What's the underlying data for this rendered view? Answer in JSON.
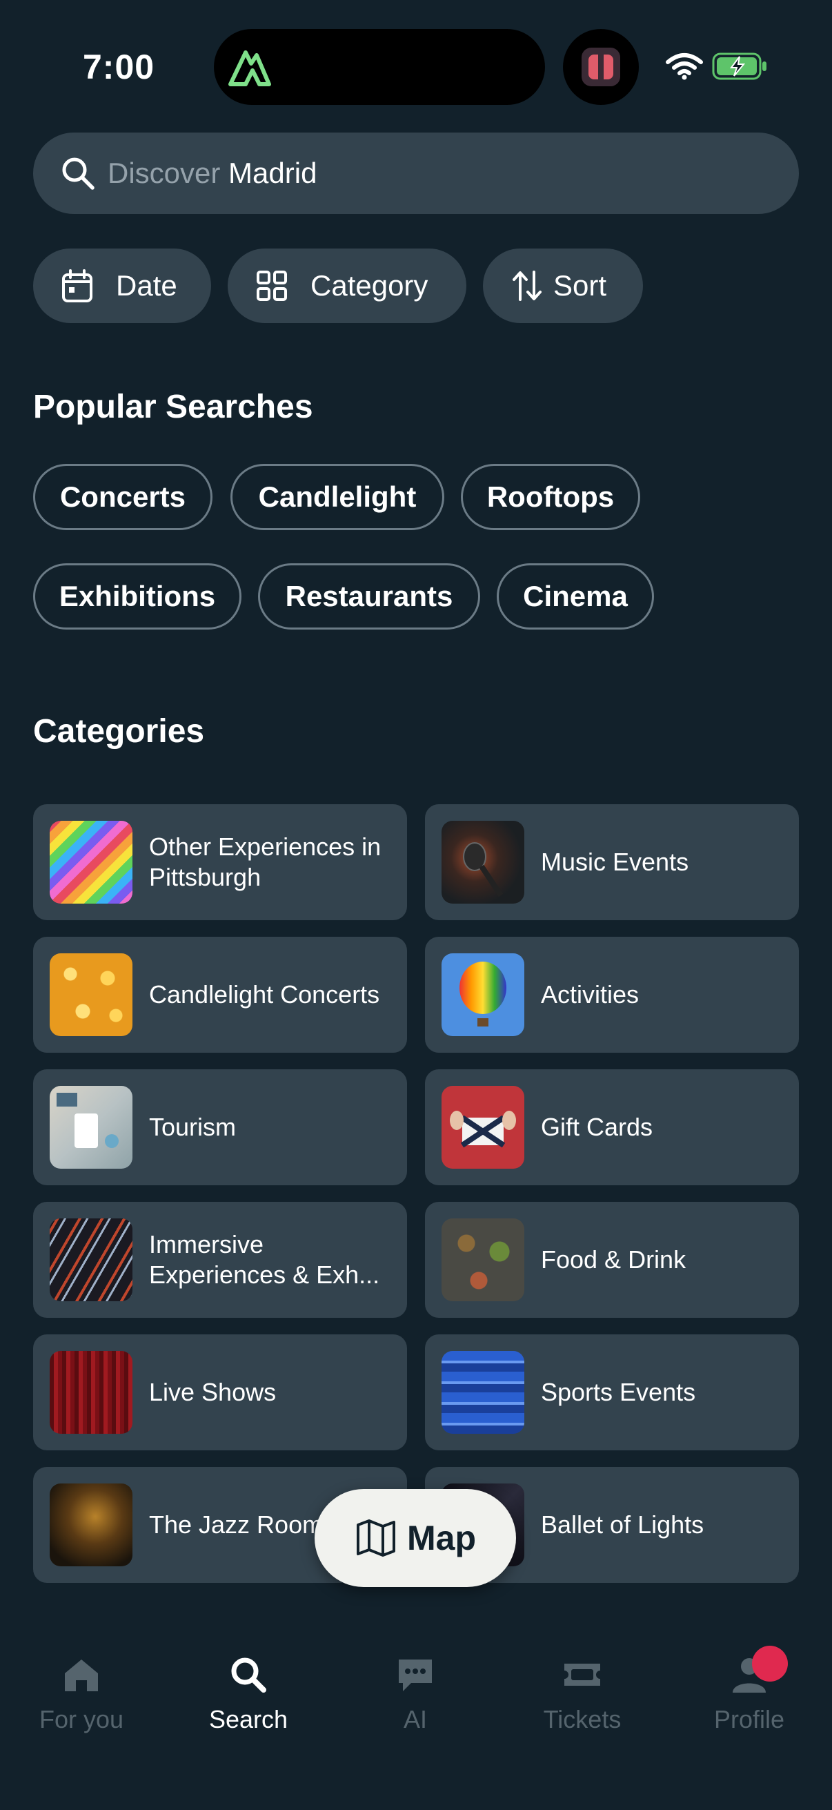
{
  "status_bar": {
    "time": "7:00"
  },
  "search": {
    "placeholder": "Discover",
    "value": "Madrid"
  },
  "filters": [
    {
      "label": "Date",
      "icon": "calendar-icon"
    },
    {
      "label": "Category",
      "icon": "grid-icon"
    },
    {
      "label": "Sort",
      "icon": "sort-arrows-icon"
    }
  ],
  "popular_searches": {
    "title": "Popular Searches",
    "items": [
      "Concerts",
      "Candlelight",
      "Rooftops",
      "Exhibitions",
      "Restaurants",
      "Cinema"
    ]
  },
  "categories": {
    "title": "Categories",
    "items": [
      {
        "label": "Other Experiences in Pittsburgh",
        "thumb": "rainbow-stripes"
      },
      {
        "label": "Music Events",
        "thumb": "microphone"
      },
      {
        "label": "Candlelight Concerts",
        "thumb": "candles"
      },
      {
        "label": "Activities",
        "thumb": "hot-air-balloon"
      },
      {
        "label": "Tourism",
        "thumb": "map-and-phone"
      },
      {
        "label": "Gift Cards",
        "thumb": "gift-box"
      },
      {
        "label": "Immersive Experiences & Exh...",
        "thumb": "light-streaks"
      },
      {
        "label": "Food & Drink",
        "thumb": "food-table"
      },
      {
        "label": "Live Shows",
        "thumb": "red-curtain"
      },
      {
        "label": "Sports Events",
        "thumb": "stadium-seats"
      },
      {
        "label": "The Jazz Room",
        "thumb": "saxophone-player"
      },
      {
        "label": "Ballet of Lights",
        "thumb": "ballet-lights"
      }
    ]
  },
  "map_button": {
    "label": "Map",
    "icon": "map-icon"
  },
  "bottom_nav": {
    "items": [
      {
        "label": "For you",
        "icon": "home-icon",
        "active": false
      },
      {
        "label": "Search",
        "icon": "search-icon",
        "active": true
      },
      {
        "label": "AI",
        "icon": "chat-bubble-icon",
        "active": false
      },
      {
        "label": "Tickets",
        "icon": "ticket-icon",
        "active": false
      },
      {
        "label": "Profile",
        "icon": "person-icon",
        "active": false,
        "badge": true
      }
    ]
  },
  "colors": {
    "background": "#12212b",
    "card": "#33434e",
    "badge": "#e0294f",
    "map_button": "#f1f2ee",
    "nav_inactive": "#55646d"
  }
}
